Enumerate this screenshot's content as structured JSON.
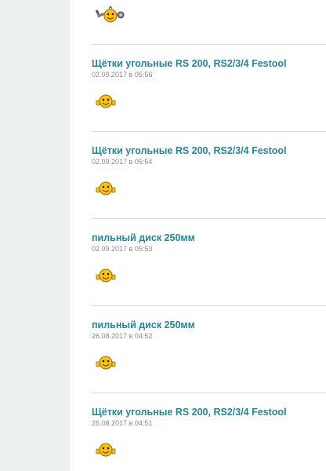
{
  "posts": [
    {
      "title": "Щётки угольные RS 200, RS2/3/4 Festool",
      "date": "02.09.2017 в 05:56",
      "emoji": "smiley-thumbs-icon"
    },
    {
      "title": "Щётки угольные RS 200, RS2/3/4 Festool",
      "date": "02.09.2017 в 05:54",
      "emoji": "smiley-thumbs-icon"
    },
    {
      "title": "пильный диск 250мм",
      "date": "02.09.2017 в 05:53",
      "emoji": "smiley-thumbs-icon"
    },
    {
      "title": "пильный диск 250мм",
      "date": "26.08.2017 в 04:52",
      "emoji": "smiley-thumbs-icon"
    },
    {
      "title": "Щётки угольные RS 200, RS2/3/4 Festool",
      "date": "26.08.2017 в 04:51",
      "emoji": "smiley-thumbs-icon"
    }
  ],
  "top_emoji": "smiley-with-tools-icon",
  "colors": {
    "title": "#23879a",
    "date": "#8a8a8a",
    "divider": "#dcdcdc",
    "gutter": "#edf0f0"
  }
}
